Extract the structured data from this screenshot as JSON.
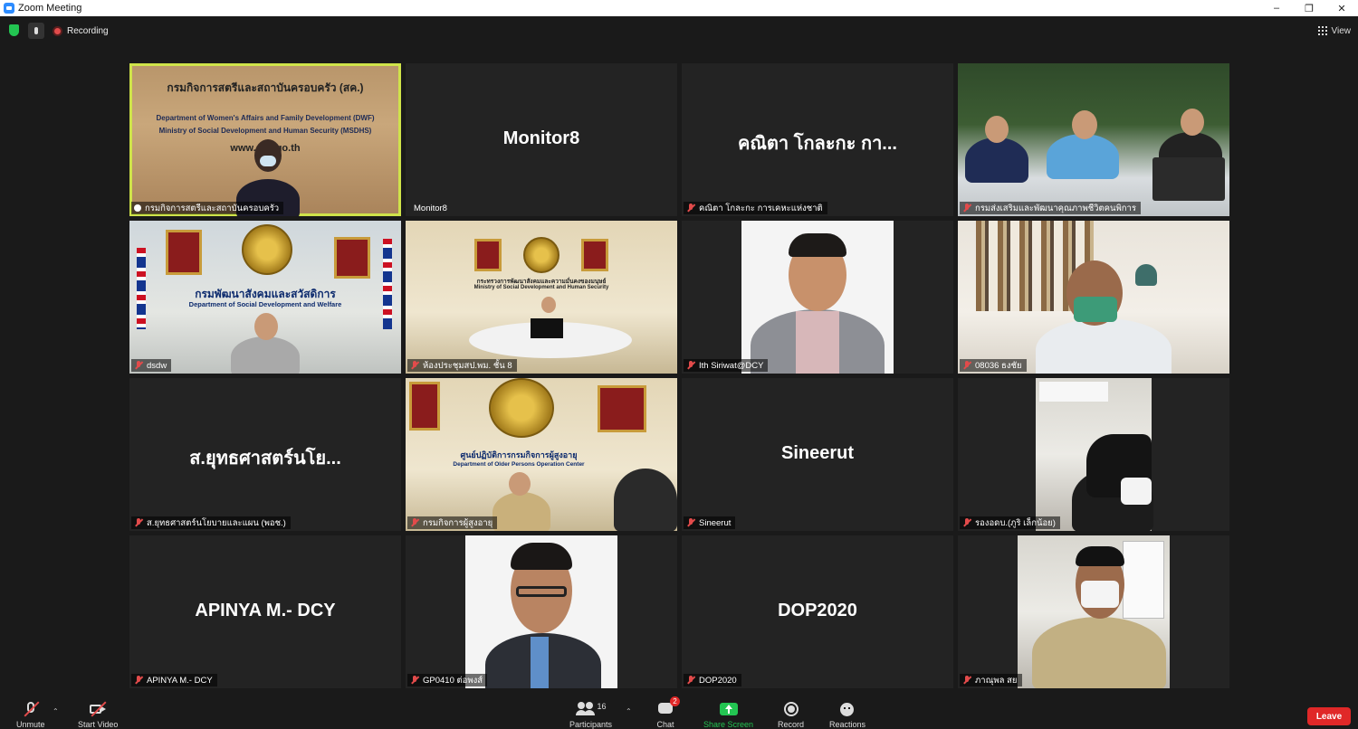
{
  "window": {
    "title": "Zoom Meeting",
    "minimize": "–",
    "restore": "❐",
    "close": "✕"
  },
  "topbar": {
    "recording_label": "Recording",
    "view_label": "View"
  },
  "tiles": [
    {
      "name": "กรมกิจการสตรีและสถาบันครอบครัว",
      "big": "",
      "wall1": "กรมกิจการสตรีและสถาบันครอบครัว (สค.)",
      "wall2": "Department of Women's Affairs and Family Development (DWF)",
      "wall3": "Ministry of Social Development and Human Security (MSDHS)",
      "wall4": "www.dwf.go.th"
    },
    {
      "name": "Monitor8",
      "big": "Monitor8"
    },
    {
      "name": "คณิตา โกละกะ การเคหะแห่งชาติ",
      "big": "คณิตา โกละกะ กา..."
    },
    {
      "name": "กรมส่งเสริมและพัฒนาคุณภาพชีวิตคนพิการ",
      "big": ""
    },
    {
      "name": "dsdw",
      "big": "",
      "wall1": "กรมพัฒนาสังคมและสวัสดิการ",
      "wall2": "Department of Social Development and Welfare"
    },
    {
      "name": "ห้องประชุมสป.พม. ชั้น 8",
      "big": "",
      "wall1": "กระทรวงการพัฒนาสังคมและความมั่นคงของมนุษย์",
      "wall2": "Ministry of Social Development and Human Security"
    },
    {
      "name": "Ith Siriwat@DCY",
      "big": ""
    },
    {
      "name": "08036 ธงชัย",
      "big": ""
    },
    {
      "name": "ส.ยุทธศาสตร์นโยบายและแผน (พอช.)",
      "big": "ส.ยุทธศาสตร์นโย..."
    },
    {
      "name": "กรมกิจการผู้สูงอายุ",
      "big": "",
      "wall1": "ศูนย์ปฏิบัติการกรมกิจการผู้สูงอายุ",
      "wall2": "Department of Older Persons Operation Center"
    },
    {
      "name": "Sineerut",
      "big": "Sineerut"
    },
    {
      "name": "รองอดบ.(ภูริ เล็กน้อย)",
      "big": ""
    },
    {
      "name": "APINYA  M.- DCY",
      "big": "APINYA  M.- DCY"
    },
    {
      "name": "GP0410 ต่อพงส์",
      "big": ""
    },
    {
      "name": "DOP2020",
      "big": "DOP2020"
    },
    {
      "name": "ภาณุพล สย",
      "big": ""
    }
  ],
  "bottombar": {
    "unmute": "Unmute",
    "start_video": "Start Video",
    "participants": "Participants",
    "participant_count": "16",
    "chat": "Chat",
    "chat_badge": "2",
    "share_screen": "Share Screen",
    "record": "Record",
    "reactions": "Reactions",
    "leave": "Leave"
  },
  "colors": {
    "accent_speaker": "#cfe34a",
    "leave": "#e02828",
    "share": "#23c552"
  }
}
